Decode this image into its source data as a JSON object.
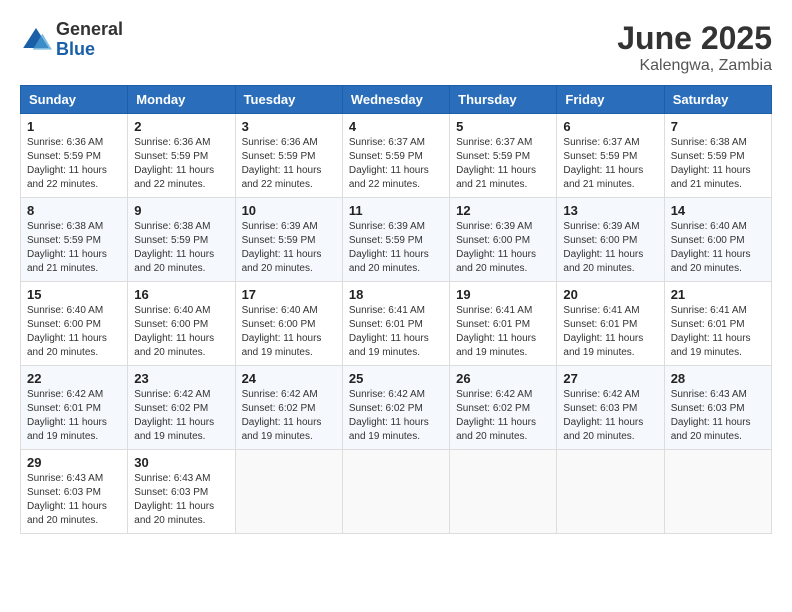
{
  "logo": {
    "general": "General",
    "blue": "Blue"
  },
  "header": {
    "month": "June 2025",
    "location": "Kalengwa, Zambia"
  },
  "weekdays": [
    "Sunday",
    "Monday",
    "Tuesday",
    "Wednesday",
    "Thursday",
    "Friday",
    "Saturday"
  ],
  "weeks": [
    [
      {
        "day": "1",
        "sunrise": "6:36 AM",
        "sunset": "5:59 PM",
        "daylight": "11 hours and 22 minutes."
      },
      {
        "day": "2",
        "sunrise": "6:36 AM",
        "sunset": "5:59 PM",
        "daylight": "11 hours and 22 minutes."
      },
      {
        "day": "3",
        "sunrise": "6:36 AM",
        "sunset": "5:59 PM",
        "daylight": "11 hours and 22 minutes."
      },
      {
        "day": "4",
        "sunrise": "6:37 AM",
        "sunset": "5:59 PM",
        "daylight": "11 hours and 22 minutes."
      },
      {
        "day": "5",
        "sunrise": "6:37 AM",
        "sunset": "5:59 PM",
        "daylight": "11 hours and 21 minutes."
      },
      {
        "day": "6",
        "sunrise": "6:37 AM",
        "sunset": "5:59 PM",
        "daylight": "11 hours and 21 minutes."
      },
      {
        "day": "7",
        "sunrise": "6:38 AM",
        "sunset": "5:59 PM",
        "daylight": "11 hours and 21 minutes."
      }
    ],
    [
      {
        "day": "8",
        "sunrise": "6:38 AM",
        "sunset": "5:59 PM",
        "daylight": "11 hours and 21 minutes."
      },
      {
        "day": "9",
        "sunrise": "6:38 AM",
        "sunset": "5:59 PM",
        "daylight": "11 hours and 20 minutes."
      },
      {
        "day": "10",
        "sunrise": "6:39 AM",
        "sunset": "5:59 PM",
        "daylight": "11 hours and 20 minutes."
      },
      {
        "day": "11",
        "sunrise": "6:39 AM",
        "sunset": "5:59 PM",
        "daylight": "11 hours and 20 minutes."
      },
      {
        "day": "12",
        "sunrise": "6:39 AM",
        "sunset": "6:00 PM",
        "daylight": "11 hours and 20 minutes."
      },
      {
        "day": "13",
        "sunrise": "6:39 AM",
        "sunset": "6:00 PM",
        "daylight": "11 hours and 20 minutes."
      },
      {
        "day": "14",
        "sunrise": "6:40 AM",
        "sunset": "6:00 PM",
        "daylight": "11 hours and 20 minutes."
      }
    ],
    [
      {
        "day": "15",
        "sunrise": "6:40 AM",
        "sunset": "6:00 PM",
        "daylight": "11 hours and 20 minutes."
      },
      {
        "day": "16",
        "sunrise": "6:40 AM",
        "sunset": "6:00 PM",
        "daylight": "11 hours and 20 minutes."
      },
      {
        "day": "17",
        "sunrise": "6:40 AM",
        "sunset": "6:00 PM",
        "daylight": "11 hours and 19 minutes."
      },
      {
        "day": "18",
        "sunrise": "6:41 AM",
        "sunset": "6:01 PM",
        "daylight": "11 hours and 19 minutes."
      },
      {
        "day": "19",
        "sunrise": "6:41 AM",
        "sunset": "6:01 PM",
        "daylight": "11 hours and 19 minutes."
      },
      {
        "day": "20",
        "sunrise": "6:41 AM",
        "sunset": "6:01 PM",
        "daylight": "11 hours and 19 minutes."
      },
      {
        "day": "21",
        "sunrise": "6:41 AM",
        "sunset": "6:01 PM",
        "daylight": "11 hours and 19 minutes."
      }
    ],
    [
      {
        "day": "22",
        "sunrise": "6:42 AM",
        "sunset": "6:01 PM",
        "daylight": "11 hours and 19 minutes."
      },
      {
        "day": "23",
        "sunrise": "6:42 AM",
        "sunset": "6:02 PM",
        "daylight": "11 hours and 19 minutes."
      },
      {
        "day": "24",
        "sunrise": "6:42 AM",
        "sunset": "6:02 PM",
        "daylight": "11 hours and 19 minutes."
      },
      {
        "day": "25",
        "sunrise": "6:42 AM",
        "sunset": "6:02 PM",
        "daylight": "11 hours and 19 minutes."
      },
      {
        "day": "26",
        "sunrise": "6:42 AM",
        "sunset": "6:02 PM",
        "daylight": "11 hours and 20 minutes."
      },
      {
        "day": "27",
        "sunrise": "6:42 AM",
        "sunset": "6:03 PM",
        "daylight": "11 hours and 20 minutes."
      },
      {
        "day": "28",
        "sunrise": "6:43 AM",
        "sunset": "6:03 PM",
        "daylight": "11 hours and 20 minutes."
      }
    ],
    [
      {
        "day": "29",
        "sunrise": "6:43 AM",
        "sunset": "6:03 PM",
        "daylight": "11 hours and 20 minutes."
      },
      {
        "day": "30",
        "sunrise": "6:43 AM",
        "sunset": "6:03 PM",
        "daylight": "11 hours and 20 minutes."
      },
      null,
      null,
      null,
      null,
      null
    ]
  ]
}
